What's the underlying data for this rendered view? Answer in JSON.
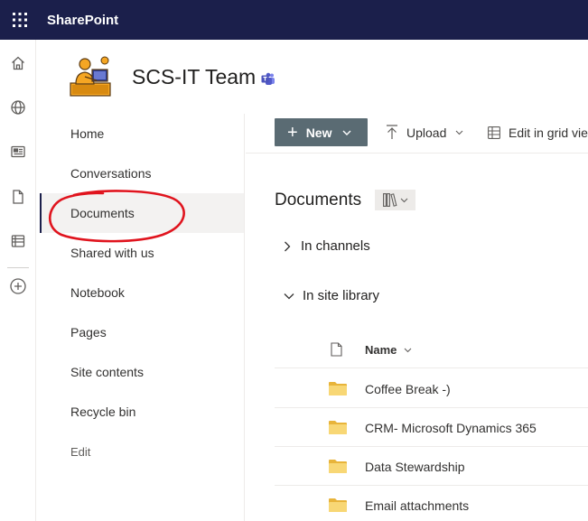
{
  "suite": {
    "title": "SharePoint"
  },
  "site": {
    "title": "SCS-IT Team"
  },
  "nav": {
    "items": [
      {
        "label": "Home"
      },
      {
        "label": "Conversations"
      },
      {
        "label": "Documents",
        "selected": true
      },
      {
        "label": "Shared with us"
      },
      {
        "label": "Notebook"
      },
      {
        "label": "Pages"
      },
      {
        "label": "Site contents"
      },
      {
        "label": "Recycle bin"
      }
    ],
    "edit_label": "Edit"
  },
  "commandbar": {
    "new_label": "New",
    "upload_label": "Upload",
    "grid_label": "Edit in grid vie"
  },
  "library": {
    "title": "Documents",
    "groups": [
      {
        "label": "In channels",
        "expanded": false
      },
      {
        "label": "In site library",
        "expanded": true
      }
    ],
    "columns": {
      "name": "Name"
    },
    "rows": [
      {
        "name": "Coffee Break  -)"
      },
      {
        "name": "CRM- Microsoft Dynamics 365"
      },
      {
        "name": "Data Stewardship"
      },
      {
        "name": "Email attachments"
      }
    ]
  },
  "colors": {
    "suitebar": "#1b1f4b",
    "new_button": "#5a6b73",
    "folder": "#f8d775",
    "annotation": "#e0141e"
  },
  "icons": {
    "waffle": "waffle-icon",
    "home": "home-icon",
    "globe": "globe-icon",
    "news": "news-icon",
    "file": "file-icon",
    "lists": "lists-icon",
    "add": "add-circle-icon",
    "teams": "teams-icon",
    "upload": "upload-icon",
    "grid": "grid-icon",
    "library_view": "library-view-icon",
    "folder": "folder-icon"
  }
}
